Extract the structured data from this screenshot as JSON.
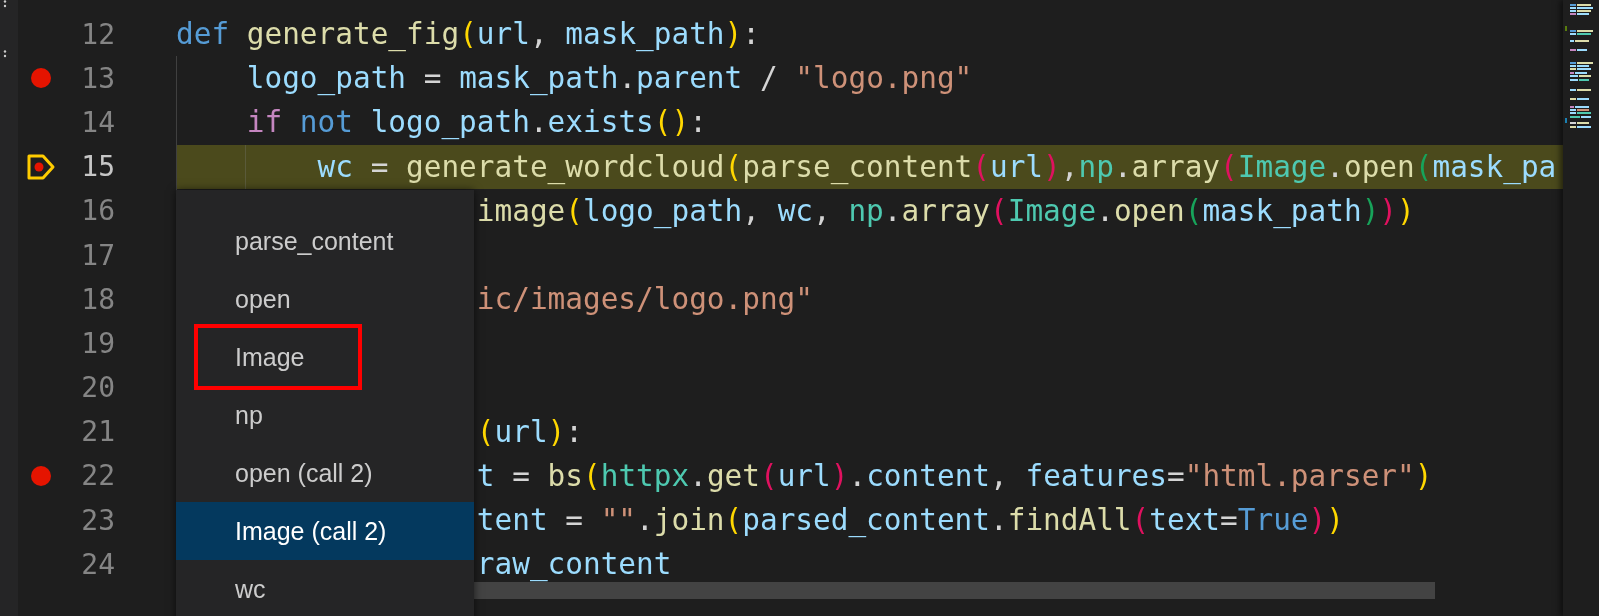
{
  "editor": {
    "lines": [
      {
        "number": "12",
        "breakpoint": false,
        "current": false,
        "tokens": [
          {
            "kind": "keyword",
            "text": "def "
          },
          {
            "kind": "function",
            "text": "generate_fig"
          },
          {
            "kind": "bracket1",
            "text": "("
          },
          {
            "kind": "variable",
            "text": "url"
          },
          {
            "kind": "plain",
            "text": ", "
          },
          {
            "kind": "variable",
            "text": "mask_path"
          },
          {
            "kind": "bracket1",
            "text": ")"
          },
          {
            "kind": "plain",
            "text": ":"
          }
        ],
        "children": [
          {
            "number": "13",
            "breakpoint": true,
            "current": false,
            "tokens": [
              {
                "kind": "variable",
                "text": "logo_path"
              },
              {
                "kind": "plain",
                "text": " = "
              },
              {
                "kind": "variable",
                "text": "mask_path"
              },
              {
                "kind": "plain",
                "text": "."
              },
              {
                "kind": "variable",
                "text": "parent"
              },
              {
                "kind": "plain",
                "text": " / "
              },
              {
                "kind": "string",
                "text": "\"logo.png\""
              }
            ]
          },
          {
            "number": "14",
            "breakpoint": false,
            "current": false,
            "tokens": [
              {
                "kind": "control",
                "text": "if "
              },
              {
                "kind": "keyword",
                "text": "not "
              },
              {
                "kind": "variable",
                "text": "logo_path"
              },
              {
                "kind": "plain",
                "text": "."
              },
              {
                "kind": "variable",
                "text": "exists"
              },
              {
                "kind": "bracket1",
                "text": "()"
              },
              {
                "kind": "plain",
                "text": ":"
              }
            ],
            "children": [
              {
                "number": "15",
                "breakpoint": true,
                "current": true,
                "tokens": [
                  {
                    "kind": "variable",
                    "text": "wc"
                  },
                  {
                    "kind": "plain",
                    "text": " = "
                  },
                  {
                    "kind": "function",
                    "text": "generate_wordcloud"
                  },
                  {
                    "kind": "bracket1",
                    "text": "("
                  },
                  {
                    "kind": "function",
                    "text": "parse_content"
                  },
                  {
                    "kind": "bracket2",
                    "text": "("
                  },
                  {
                    "kind": "variable",
                    "text": "url"
                  },
                  {
                    "kind": "bracket2",
                    "text": ")"
                  },
                  {
                    "kind": "plain",
                    "text": ","
                  },
                  {
                    "kind": "type",
                    "text": "np"
                  },
                  {
                    "kind": "plain",
                    "text": "."
                  },
                  {
                    "kind": "function",
                    "text": "array"
                  },
                  {
                    "kind": "bracket2",
                    "text": "("
                  },
                  {
                    "kind": "type",
                    "text": "Image"
                  },
                  {
                    "kind": "plain",
                    "text": "."
                  },
                  {
                    "kind": "function",
                    "text": "open"
                  },
                  {
                    "kind": "bracket3",
                    "text": "("
                  },
                  {
                    "kind": "variable",
                    "text": "mask_pa"
                  }
                ]
              }
            ]
          }
        ]
      }
    ],
    "lines_behind_menu": [
      {
        "number": "16",
        "breakpoint": false,
        "tokens": [
          {
            "kind": "function",
            "text": "image"
          },
          {
            "kind": "bracket1",
            "text": "("
          },
          {
            "kind": "variable",
            "text": "logo_path"
          },
          {
            "kind": "plain",
            "text": ", "
          },
          {
            "kind": "variable",
            "text": "wc"
          },
          {
            "kind": "plain",
            "text": ", "
          },
          {
            "kind": "type",
            "text": "np"
          },
          {
            "kind": "plain",
            "text": "."
          },
          {
            "kind": "function",
            "text": "array"
          },
          {
            "kind": "bracket2",
            "text": "("
          },
          {
            "kind": "type",
            "text": "Image"
          },
          {
            "kind": "plain",
            "text": "."
          },
          {
            "kind": "function",
            "text": "open"
          },
          {
            "kind": "bracket3",
            "text": "("
          },
          {
            "kind": "variable",
            "text": "mask_path"
          },
          {
            "kind": "bracket3",
            "text": ")"
          },
          {
            "kind": "bracket2",
            "text": ")"
          },
          {
            "kind": "bracket1",
            "text": ")"
          }
        ]
      },
      {
        "number": "17",
        "breakpoint": false
      },
      {
        "number": "18",
        "breakpoint": false,
        "tokens": [
          {
            "kind": "string",
            "text": "ic/images/logo.png\""
          }
        ]
      },
      {
        "number": "19",
        "breakpoint": false
      },
      {
        "number": "20",
        "breakpoint": false
      },
      {
        "number": "21",
        "breakpoint": false,
        "tokens": [
          {
            "kind": "bracket1",
            "text": "("
          },
          {
            "kind": "variable",
            "text": "url"
          },
          {
            "kind": "bracket1",
            "text": ")"
          },
          {
            "kind": "plain",
            "text": ":"
          }
        ]
      },
      {
        "number": "22",
        "breakpoint": true,
        "tokens": [
          {
            "kind": "variable",
            "text": "t"
          },
          {
            "kind": "plain",
            "text": " = "
          },
          {
            "kind": "function",
            "text": "bs"
          },
          {
            "kind": "bracket1",
            "text": "("
          },
          {
            "kind": "type",
            "text": "httpx"
          },
          {
            "kind": "plain",
            "text": "."
          },
          {
            "kind": "function",
            "text": "get"
          },
          {
            "kind": "bracket2",
            "text": "("
          },
          {
            "kind": "variable",
            "text": "url"
          },
          {
            "kind": "bracket2",
            "text": ")"
          },
          {
            "kind": "plain",
            "text": "."
          },
          {
            "kind": "variable",
            "text": "content"
          },
          {
            "kind": "plain",
            "text": ", "
          },
          {
            "kind": "variable",
            "text": "features"
          },
          {
            "kind": "plain",
            "text": "="
          },
          {
            "kind": "string",
            "text": "\"html.parser\""
          },
          {
            "kind": "bracket1",
            "text": ")"
          }
        ]
      },
      {
        "number": "23",
        "breakpoint": false,
        "tokens": [
          {
            "kind": "variable",
            "text": "tent"
          },
          {
            "kind": "plain",
            "text": " = "
          },
          {
            "kind": "string",
            "text": "\"\""
          },
          {
            "kind": "plain",
            "text": "."
          },
          {
            "kind": "function",
            "text": "join"
          },
          {
            "kind": "bracket1",
            "text": "("
          },
          {
            "kind": "variable",
            "text": "parsed_content"
          },
          {
            "kind": "plain",
            "text": "."
          },
          {
            "kind": "function",
            "text": "findAll"
          },
          {
            "kind": "bracket2",
            "text": "("
          },
          {
            "kind": "variable",
            "text": "text"
          },
          {
            "kind": "plain",
            "text": "="
          },
          {
            "kind": "keyword",
            "text": "True"
          },
          {
            "kind": "bracket2",
            "text": ")"
          },
          {
            "kind": "bracket1",
            "text": ")"
          }
        ]
      },
      {
        "number": "24",
        "breakpoint": false,
        "tokens": [
          {
            "kind": "variable",
            "text": "raw_content"
          }
        ]
      }
    ]
  },
  "step_targets": {
    "items": [
      {
        "label": "parse_content",
        "selected": false,
        "outlined": false
      },
      {
        "label": "open",
        "selected": false,
        "outlined": false
      },
      {
        "label": "Image",
        "selected": false,
        "outlined": true
      },
      {
        "label": "np",
        "selected": false,
        "outlined": false
      },
      {
        "label": "open (call 2)",
        "selected": false,
        "outlined": false
      },
      {
        "label": "Image (call 2)",
        "selected": true,
        "outlined": false
      },
      {
        "label": "wc",
        "selected": false,
        "outlined": false
      }
    ]
  }
}
